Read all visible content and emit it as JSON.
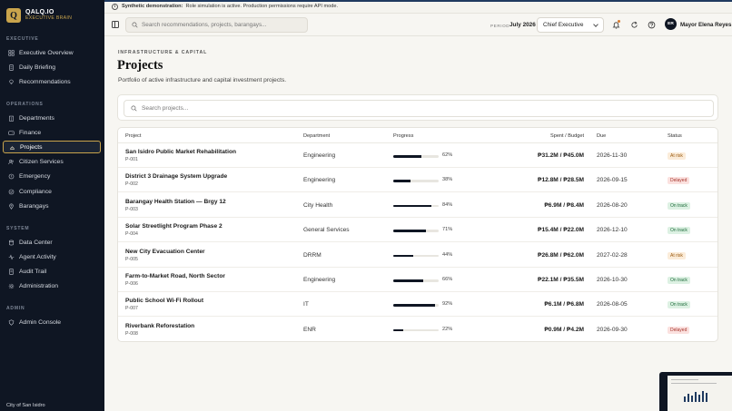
{
  "banner": {
    "label": "Synthetic demonstration:",
    "message": "Role simulation is active. Production permissions require API mode."
  },
  "brand": {
    "logo_letter": "Q",
    "name": "QALQ.IO",
    "tagline": "EXECUTIVE BRAIN"
  },
  "sidebar": {
    "sections": [
      {
        "title": "EXECUTIVE",
        "items": [
          {
            "label": "Executive Overview",
            "icon": "grid-icon"
          },
          {
            "label": "Daily Briefing",
            "icon": "document-icon"
          },
          {
            "label": "Recommendations",
            "icon": "lightbulb-icon"
          }
        ]
      },
      {
        "title": "OPERATIONS",
        "items": [
          {
            "label": "Departments",
            "icon": "building-icon"
          },
          {
            "label": "Finance",
            "icon": "wallet-icon"
          },
          {
            "label": "Projects",
            "icon": "hardhat-icon",
            "active": true
          },
          {
            "label": "Citizen Services",
            "icon": "users-icon"
          },
          {
            "label": "Emergency",
            "icon": "siren-icon"
          },
          {
            "label": "Compliance",
            "icon": "check-shield-icon"
          },
          {
            "label": "Barangays",
            "icon": "map-pin-icon"
          }
        ]
      },
      {
        "title": "SYSTEM",
        "items": [
          {
            "label": "Data Center",
            "icon": "database-icon"
          },
          {
            "label": "Agent Activity",
            "icon": "activity-icon"
          },
          {
            "label": "Audit Trail",
            "icon": "list-icon"
          },
          {
            "label": "Administration",
            "icon": "gear-icon"
          }
        ]
      },
      {
        "title": "ADMIN",
        "items": [
          {
            "label": "Admin Console",
            "icon": "shield-icon"
          }
        ]
      }
    ],
    "footer": "City of San Isidro"
  },
  "topbar": {
    "search_placeholder": "Search recommendations, projects, barangays...",
    "period_label": "PERIOD",
    "period_value": "July 2026",
    "role": "Chief Executive",
    "user_initials": "ER",
    "user_name": "Mayor Elena Reyes"
  },
  "page": {
    "eyebrow": "INFRASTRUCTURE & CAPITAL",
    "title": "Projects",
    "subtitle": "Portfolio of active infrastructure and capital investment projects.",
    "search_placeholder": "Search projects..."
  },
  "table": {
    "headers": {
      "project": "Project",
      "department": "Department",
      "progress": "Progress",
      "spent": "Spent / Budget",
      "due": "Due",
      "status": "Status"
    },
    "rows": [
      {
        "name": "San Isidro Public Market Rehabilitation",
        "id": "P-001",
        "dept": "Engineering",
        "progress": 62,
        "progress_label": "62%",
        "spent": "₱31.2M / ₱45.0M",
        "due": "2026-11-30",
        "status": "At risk",
        "status_kind": "risk"
      },
      {
        "name": "District 3 Drainage System Upgrade",
        "id": "P-002",
        "dept": "Engineering",
        "progress": 38,
        "progress_label": "38%",
        "spent": "₱12.8M / ₱28.5M",
        "due": "2026-09-15",
        "status": "Delayed",
        "status_kind": "delayed"
      },
      {
        "name": "Barangay Health Station — Brgy 12",
        "id": "P-003",
        "dept": "City Health",
        "progress": 84,
        "progress_label": "84%",
        "spent": "₱6.9M / ₱8.4M",
        "due": "2026-08-20",
        "status": "On track",
        "status_kind": "ontrack"
      },
      {
        "name": "Solar Streetlight Program Phase 2",
        "id": "P-004",
        "dept": "General Services",
        "progress": 71,
        "progress_label": "71%",
        "spent": "₱15.4M / ₱22.0M",
        "due": "2026-12-10",
        "status": "On track",
        "status_kind": "ontrack"
      },
      {
        "name": "New City Evacuation Center",
        "id": "P-005",
        "dept": "DRRM",
        "progress": 44,
        "progress_label": "44%",
        "spent": "₱26.8M / ₱62.0M",
        "due": "2027-02-28",
        "status": "At risk",
        "status_kind": "risk"
      },
      {
        "name": "Farm-to-Market Road, North Sector",
        "id": "P-006",
        "dept": "Engineering",
        "progress": 66,
        "progress_label": "66%",
        "spent": "₱22.1M / ₱35.5M",
        "due": "2026-10-30",
        "status": "On track",
        "status_kind": "ontrack"
      },
      {
        "name": "Public School Wi-Fi Rollout",
        "id": "P-007",
        "dept": "IT",
        "progress": 92,
        "progress_label": "92%",
        "spent": "₱6.1M / ₱6.8M",
        "due": "2026-08-05",
        "status": "On track",
        "status_kind": "ontrack"
      },
      {
        "name": "Riverbank Reforestation",
        "id": "P-008",
        "dept": "ENR",
        "progress": 22,
        "progress_label": "22%",
        "spent": "₱0.9M / ₱4.2M",
        "due": "2026-09-30",
        "status": "Delayed",
        "status_kind": "delayed"
      }
    ]
  },
  "colors": {
    "sidebar_bg": "#0f1623",
    "accent_gold": "#c9a44c",
    "risk": "#9a5a10",
    "delayed": "#a5342b",
    "ontrack": "#1d6b3a"
  }
}
